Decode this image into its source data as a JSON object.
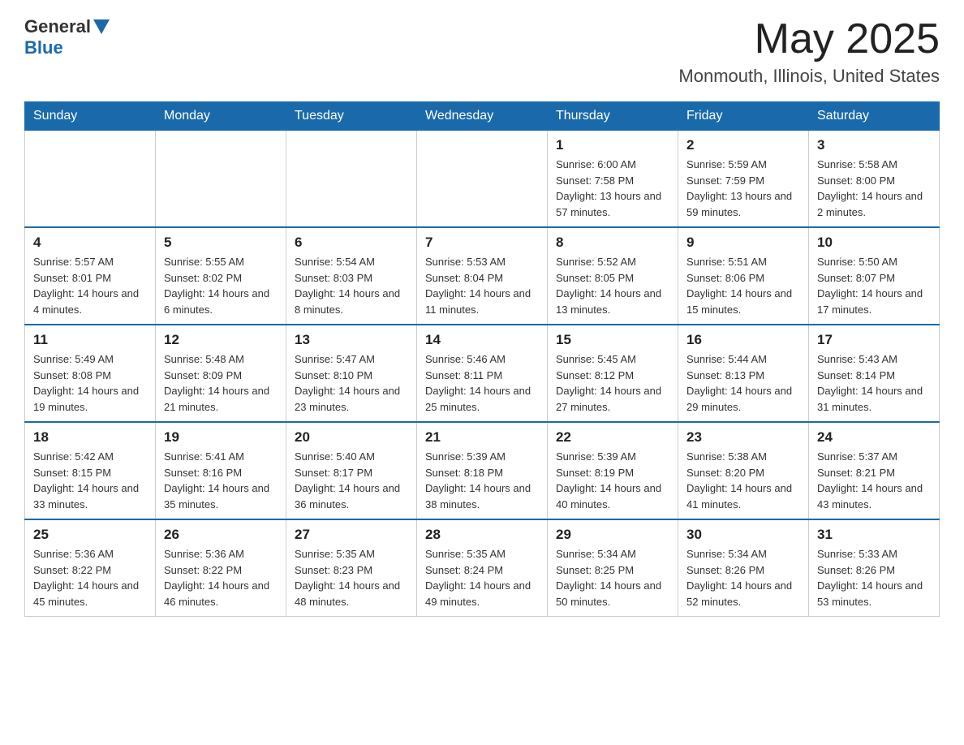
{
  "header": {
    "logo_text_general": "General",
    "logo_text_blue": "Blue",
    "title": "May 2025",
    "subtitle": "Monmouth, Illinois, United States"
  },
  "days_of_week": [
    "Sunday",
    "Monday",
    "Tuesday",
    "Wednesday",
    "Thursday",
    "Friday",
    "Saturday"
  ],
  "weeks": [
    [
      {
        "day": "",
        "sunrise": "",
        "sunset": "",
        "daylight": ""
      },
      {
        "day": "",
        "sunrise": "",
        "sunset": "",
        "daylight": ""
      },
      {
        "day": "",
        "sunrise": "",
        "sunset": "",
        "daylight": ""
      },
      {
        "day": "",
        "sunrise": "",
        "sunset": "",
        "daylight": ""
      },
      {
        "day": "1",
        "sunrise": "Sunrise: 6:00 AM",
        "sunset": "Sunset: 7:58 PM",
        "daylight": "Daylight: 13 hours and 57 minutes."
      },
      {
        "day": "2",
        "sunrise": "Sunrise: 5:59 AM",
        "sunset": "Sunset: 7:59 PM",
        "daylight": "Daylight: 13 hours and 59 minutes."
      },
      {
        "day": "3",
        "sunrise": "Sunrise: 5:58 AM",
        "sunset": "Sunset: 8:00 PM",
        "daylight": "Daylight: 14 hours and 2 minutes."
      }
    ],
    [
      {
        "day": "4",
        "sunrise": "Sunrise: 5:57 AM",
        "sunset": "Sunset: 8:01 PM",
        "daylight": "Daylight: 14 hours and 4 minutes."
      },
      {
        "day": "5",
        "sunrise": "Sunrise: 5:55 AM",
        "sunset": "Sunset: 8:02 PM",
        "daylight": "Daylight: 14 hours and 6 minutes."
      },
      {
        "day": "6",
        "sunrise": "Sunrise: 5:54 AM",
        "sunset": "Sunset: 8:03 PM",
        "daylight": "Daylight: 14 hours and 8 minutes."
      },
      {
        "day": "7",
        "sunrise": "Sunrise: 5:53 AM",
        "sunset": "Sunset: 8:04 PM",
        "daylight": "Daylight: 14 hours and 11 minutes."
      },
      {
        "day": "8",
        "sunrise": "Sunrise: 5:52 AM",
        "sunset": "Sunset: 8:05 PM",
        "daylight": "Daylight: 14 hours and 13 minutes."
      },
      {
        "day": "9",
        "sunrise": "Sunrise: 5:51 AM",
        "sunset": "Sunset: 8:06 PM",
        "daylight": "Daylight: 14 hours and 15 minutes."
      },
      {
        "day": "10",
        "sunrise": "Sunrise: 5:50 AM",
        "sunset": "Sunset: 8:07 PM",
        "daylight": "Daylight: 14 hours and 17 minutes."
      }
    ],
    [
      {
        "day": "11",
        "sunrise": "Sunrise: 5:49 AM",
        "sunset": "Sunset: 8:08 PM",
        "daylight": "Daylight: 14 hours and 19 minutes."
      },
      {
        "day": "12",
        "sunrise": "Sunrise: 5:48 AM",
        "sunset": "Sunset: 8:09 PM",
        "daylight": "Daylight: 14 hours and 21 minutes."
      },
      {
        "day": "13",
        "sunrise": "Sunrise: 5:47 AM",
        "sunset": "Sunset: 8:10 PM",
        "daylight": "Daylight: 14 hours and 23 minutes."
      },
      {
        "day": "14",
        "sunrise": "Sunrise: 5:46 AM",
        "sunset": "Sunset: 8:11 PM",
        "daylight": "Daylight: 14 hours and 25 minutes."
      },
      {
        "day": "15",
        "sunrise": "Sunrise: 5:45 AM",
        "sunset": "Sunset: 8:12 PM",
        "daylight": "Daylight: 14 hours and 27 minutes."
      },
      {
        "day": "16",
        "sunrise": "Sunrise: 5:44 AM",
        "sunset": "Sunset: 8:13 PM",
        "daylight": "Daylight: 14 hours and 29 minutes."
      },
      {
        "day": "17",
        "sunrise": "Sunrise: 5:43 AM",
        "sunset": "Sunset: 8:14 PM",
        "daylight": "Daylight: 14 hours and 31 minutes."
      }
    ],
    [
      {
        "day": "18",
        "sunrise": "Sunrise: 5:42 AM",
        "sunset": "Sunset: 8:15 PM",
        "daylight": "Daylight: 14 hours and 33 minutes."
      },
      {
        "day": "19",
        "sunrise": "Sunrise: 5:41 AM",
        "sunset": "Sunset: 8:16 PM",
        "daylight": "Daylight: 14 hours and 35 minutes."
      },
      {
        "day": "20",
        "sunrise": "Sunrise: 5:40 AM",
        "sunset": "Sunset: 8:17 PM",
        "daylight": "Daylight: 14 hours and 36 minutes."
      },
      {
        "day": "21",
        "sunrise": "Sunrise: 5:39 AM",
        "sunset": "Sunset: 8:18 PM",
        "daylight": "Daylight: 14 hours and 38 minutes."
      },
      {
        "day": "22",
        "sunrise": "Sunrise: 5:39 AM",
        "sunset": "Sunset: 8:19 PM",
        "daylight": "Daylight: 14 hours and 40 minutes."
      },
      {
        "day": "23",
        "sunrise": "Sunrise: 5:38 AM",
        "sunset": "Sunset: 8:20 PM",
        "daylight": "Daylight: 14 hours and 41 minutes."
      },
      {
        "day": "24",
        "sunrise": "Sunrise: 5:37 AM",
        "sunset": "Sunset: 8:21 PM",
        "daylight": "Daylight: 14 hours and 43 minutes."
      }
    ],
    [
      {
        "day": "25",
        "sunrise": "Sunrise: 5:36 AM",
        "sunset": "Sunset: 8:22 PM",
        "daylight": "Daylight: 14 hours and 45 minutes."
      },
      {
        "day": "26",
        "sunrise": "Sunrise: 5:36 AM",
        "sunset": "Sunset: 8:22 PM",
        "daylight": "Daylight: 14 hours and 46 minutes."
      },
      {
        "day": "27",
        "sunrise": "Sunrise: 5:35 AM",
        "sunset": "Sunset: 8:23 PM",
        "daylight": "Daylight: 14 hours and 48 minutes."
      },
      {
        "day": "28",
        "sunrise": "Sunrise: 5:35 AM",
        "sunset": "Sunset: 8:24 PM",
        "daylight": "Daylight: 14 hours and 49 minutes."
      },
      {
        "day": "29",
        "sunrise": "Sunrise: 5:34 AM",
        "sunset": "Sunset: 8:25 PM",
        "daylight": "Daylight: 14 hours and 50 minutes."
      },
      {
        "day": "30",
        "sunrise": "Sunrise: 5:34 AM",
        "sunset": "Sunset: 8:26 PM",
        "daylight": "Daylight: 14 hours and 52 minutes."
      },
      {
        "day": "31",
        "sunrise": "Sunrise: 5:33 AM",
        "sunset": "Sunset: 8:26 PM",
        "daylight": "Daylight: 14 hours and 53 minutes."
      }
    ]
  ]
}
